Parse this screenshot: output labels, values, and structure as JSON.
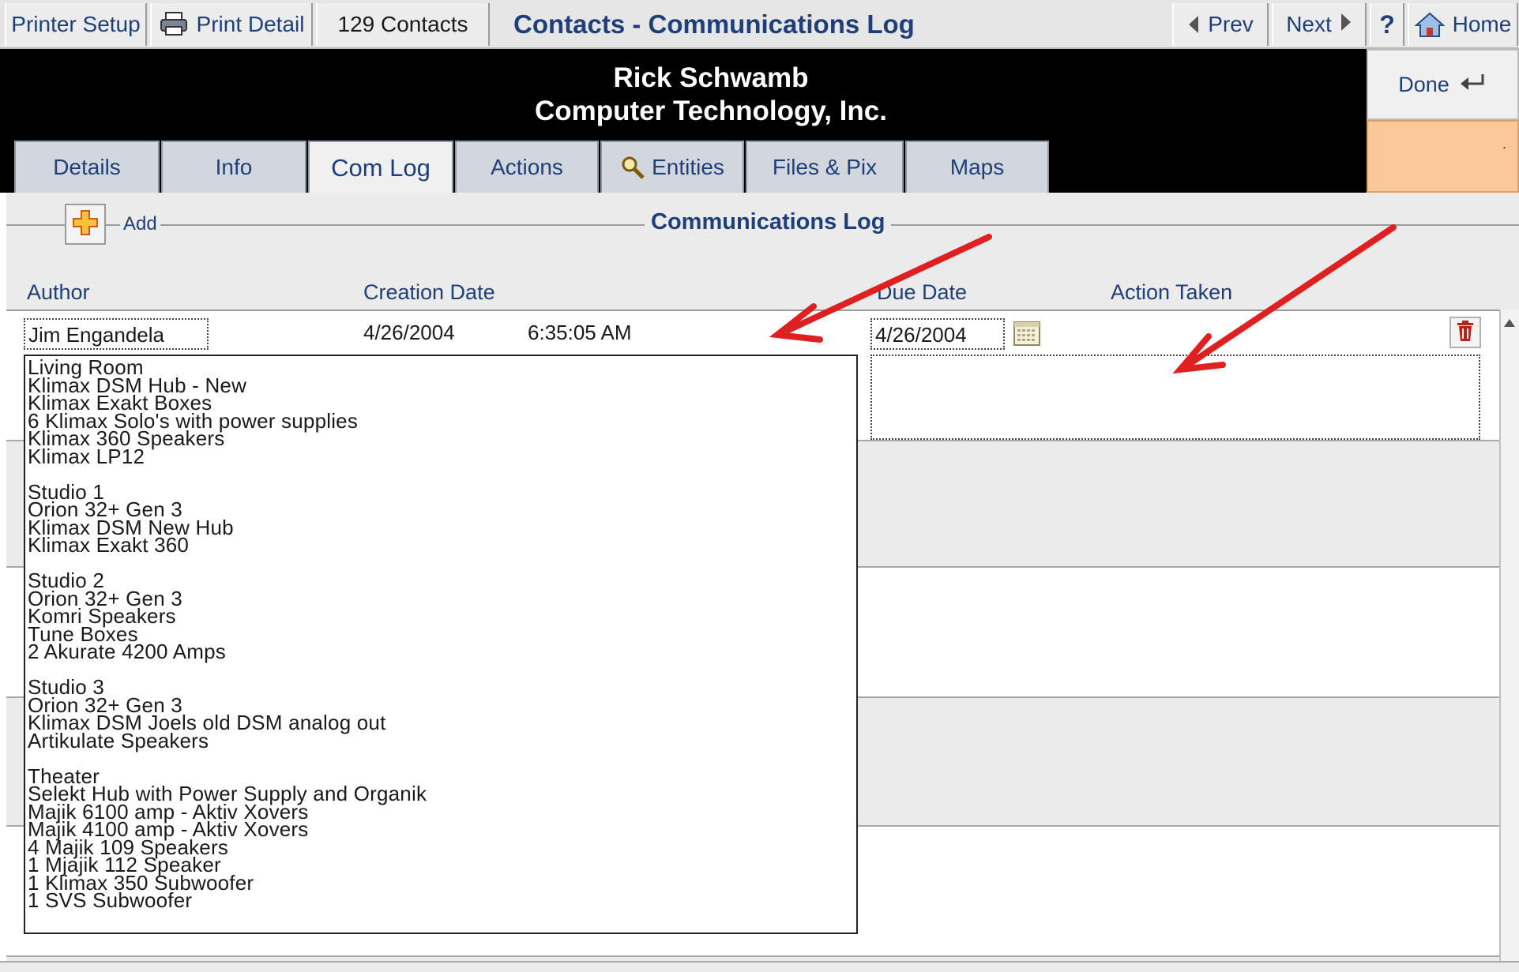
{
  "toolbar": {
    "printer_setup": "Printer Setup",
    "print_detail": "Print Detail",
    "contacts_count": "129 Contacts",
    "window_title": "Contacts - Communications Log",
    "prev": "Prev",
    "next": "Next",
    "help": "?",
    "home": "Home"
  },
  "header": {
    "name": "Rick Schwamb",
    "company": "Computer Technology, Inc."
  },
  "side": {
    "done": "Done",
    "orange_mark": "."
  },
  "tabs": [
    {
      "label": "Details"
    },
    {
      "label": "Info"
    },
    {
      "label": "Com Log"
    },
    {
      "label": "Actions"
    },
    {
      "label": "Entities"
    },
    {
      "label": "Files & Pix"
    },
    {
      "label": "Maps"
    }
  ],
  "section": {
    "add_label": "Add",
    "title": "Communications Log"
  },
  "columns": {
    "author": "Author",
    "creation_date": "Creation Date",
    "due_date": "Due Date",
    "action_taken": "Action Taken"
  },
  "record": {
    "author": "Jim Engandela",
    "creation_date": "4/26/2004",
    "creation_time": "6:35:05 AM",
    "due_date": "4/26/2004",
    "action_taken": "",
    "notes": [
      "Living Room",
      "Klimax DSM Hub - New",
      "Klimax Exakt Boxes",
      "6 Klimax Solo's with power supplies",
      "Klimax 360 Speakers",
      "Klimax LP12",
      "",
      "Studio 1",
      "Orion 32+ Gen 3",
      "Klimax DSM New Hub",
      "Klimax Exakt 360",
      "",
      "Studio 2",
      "Orion 32+ Gen 3",
      "Komri Speakers",
      "Tune Boxes",
      "2 Akurate 4200 Amps",
      "",
      "Studio 3",
      "Orion 32+ Gen 3",
      "Klimax DSM Joels old DSM analog out",
      "Artikulate Speakers",
      "",
      "Theater",
      "Selekt Hub with Power Supply and Organik",
      "Majik 6100 amp - Aktiv Xovers",
      "Majik 4100 amp - Aktiv Xovers",
      "4 Majik 109 Speakers",
      "1 Mjajik 112 Speaker",
      "1 Klimax 350 Subwoofer",
      "1 SVS Subwoofer"
    ]
  },
  "colors": {
    "accent_text": "#1f3f7a",
    "header_bg": "#000000",
    "orange_panel": "#fcc898",
    "annotation_arrow": "#e02020"
  },
  "icons": {
    "printer": "printer-icon",
    "prev": "triangle-left-icon",
    "next": "triangle-right-icon",
    "help": "question-icon",
    "home": "house-icon",
    "done": "return-arrow-icon",
    "entities": "magnifier-icon",
    "add": "plus-icon",
    "calendar": "calendar-icon",
    "trash": "trash-icon"
  }
}
